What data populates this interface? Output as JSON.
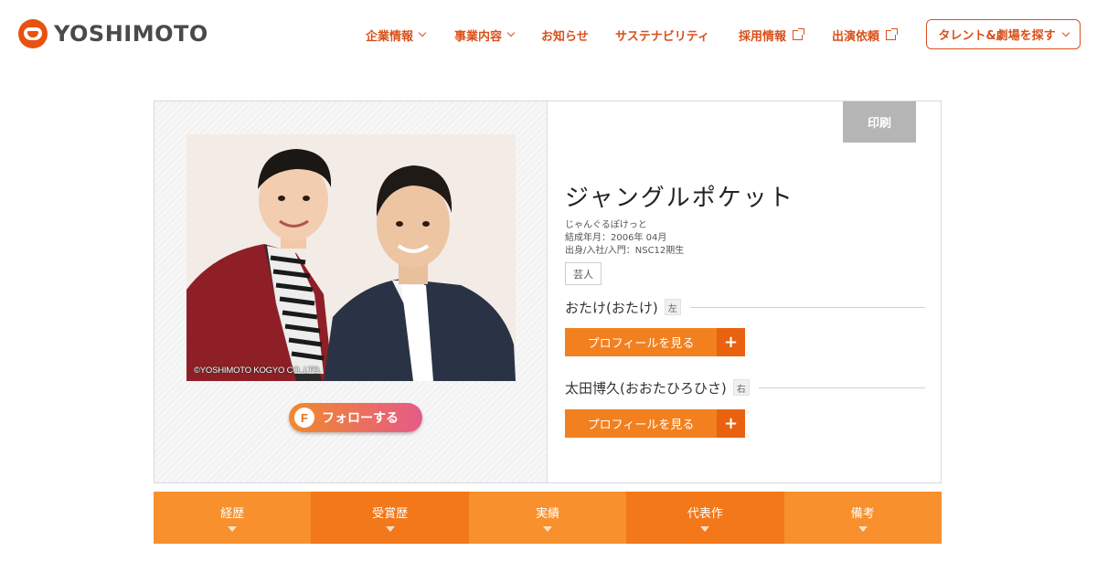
{
  "brand": {
    "name": "YOSHIMOTO",
    "accent": "#e8520f"
  },
  "nav": {
    "items": [
      {
        "label": "企業情報",
        "icon": "chevron-down-icon"
      },
      {
        "label": "事業内容",
        "icon": "chevron-down-icon"
      },
      {
        "label": "お知らせ"
      },
      {
        "label": "サステナビリティ"
      },
      {
        "label": "採用情報",
        "icon": "external-link-icon"
      },
      {
        "label": "出演依頼",
        "icon": "external-link-icon"
      }
    ],
    "search_button": "タレント&劇場を探す"
  },
  "profile": {
    "photo_credit": "©YOSHIMOTO KOGYO CO.,LTD.",
    "follow_label": "フォローする",
    "follow_icon": "F",
    "print_label": "印刷",
    "name": "ジャングルポケット",
    "kana": "じゃんぐるぽけっと",
    "formed": "結成年月：2006年 04月",
    "origin": "出身/入社/入門：NSC12期生",
    "tag": "芸人",
    "members": [
      {
        "name": "おたけ(おたけ)",
        "position": "左",
        "button": "プロフィールを見る"
      },
      {
        "name": "太田博久(おおたひろひさ)",
        "position": "右",
        "button": "プロフィールを見る"
      }
    ]
  },
  "tabs": [
    {
      "label": "経歴"
    },
    {
      "label": "受賞歴"
    },
    {
      "label": "実績"
    },
    {
      "label": "代表作"
    },
    {
      "label": "備考"
    }
  ]
}
